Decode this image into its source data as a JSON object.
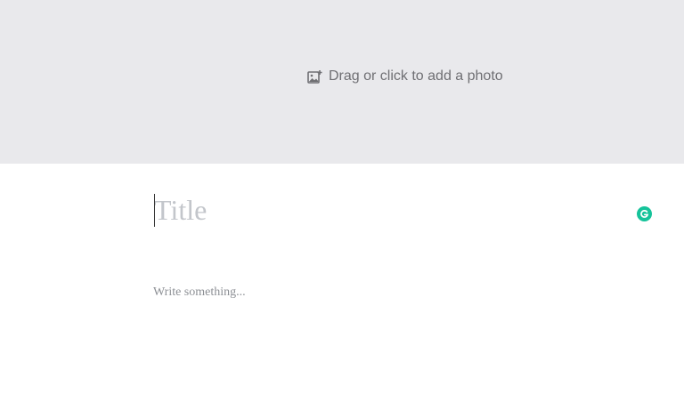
{
  "photo_upload": {
    "label": "Drag or click to add a photo",
    "icon": "add-photo-icon"
  },
  "editor": {
    "title_placeholder": "Title",
    "body_placeholder": "Write something..."
  },
  "extension": {
    "icon": "grammarly-icon",
    "color": "#15c39a"
  },
  "colors": {
    "photo_area_bg": "#e9e9ec",
    "photo_label": "#6f6f73",
    "title_placeholder": "#c3c6cb",
    "body_placeholder": "#8d9095"
  }
}
